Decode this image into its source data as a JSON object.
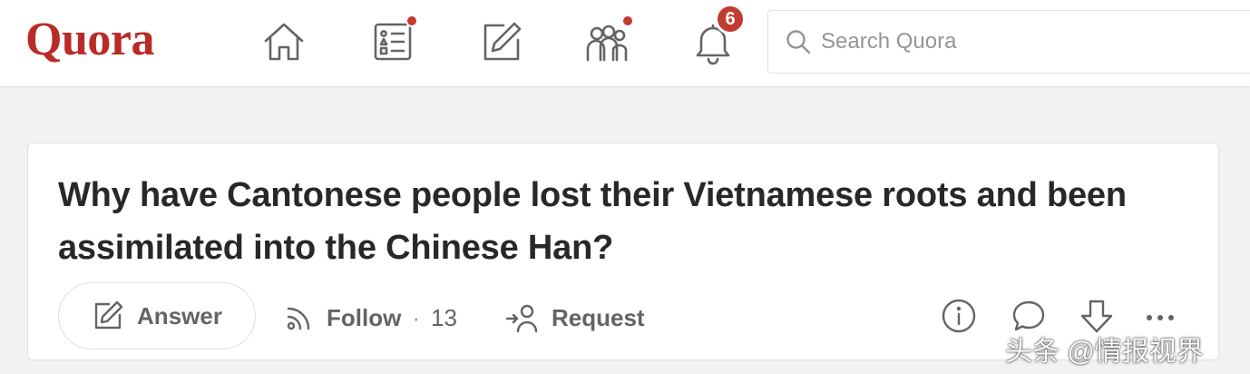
{
  "header": {
    "logo": "Quora",
    "nav": [
      {
        "name": "home",
        "icon": "home-icon"
      },
      {
        "name": "following",
        "icon": "following-list-icon",
        "has_dot": true
      },
      {
        "name": "answer",
        "icon": "edit-icon"
      },
      {
        "name": "spaces",
        "icon": "spaces-icon",
        "has_dot": true
      },
      {
        "name": "notifications",
        "icon": "bell-icon",
        "badge": "6"
      }
    ],
    "search": {
      "placeholder": "Search Quora"
    }
  },
  "question": {
    "title": "Why have Cantonese people lost their Vietnamese roots and been assimilated into the Chinese Han?",
    "actions": {
      "answer_label": "Answer",
      "follow_label": "Follow",
      "follow_separator": "·",
      "follow_count": "13",
      "request_label": "Request"
    }
  },
  "watermark": "头条 @情报视界",
  "colors": {
    "brand": "#b92b27",
    "badge": "#c33a2f",
    "background": "#f1f2f2",
    "text": "#282829",
    "muted": "#636466"
  }
}
